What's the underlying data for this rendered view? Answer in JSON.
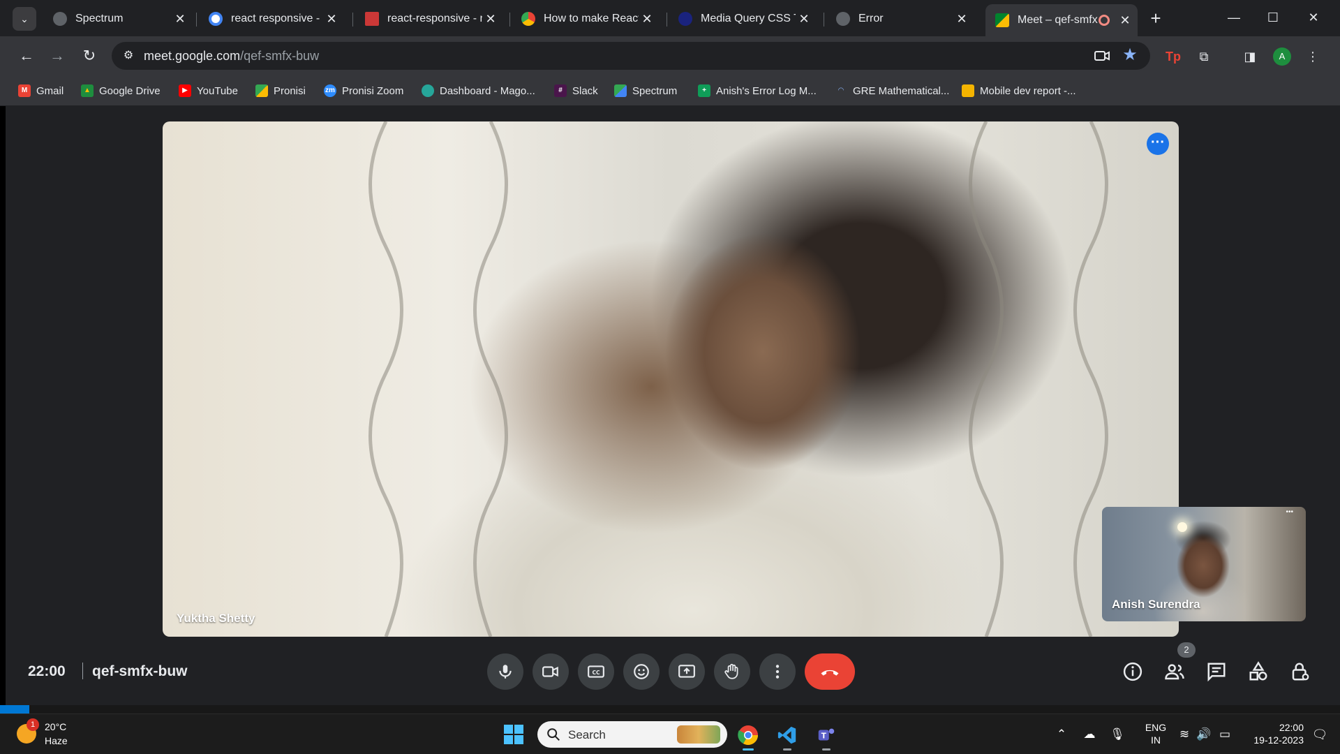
{
  "browser": {
    "tabs": [
      {
        "title": "Spectrum",
        "favicon_color": "#5f6368"
      },
      {
        "title": "react responsive - Go",
        "favicon_color": "#4285f4"
      },
      {
        "title": "react-responsive - np",
        "favicon_color": "#cb3837"
      },
      {
        "title": "How to make React A",
        "favicon_color": "#f4b400"
      },
      {
        "title": "Media Query CSS Tu",
        "favicon_color": "#1a237e"
      },
      {
        "title": "Error",
        "favicon_color": "#5f6368"
      },
      {
        "title": "Meet – qef-smfx",
        "favicon_color": "#00897b",
        "active": true
      }
    ],
    "new_tab": "+",
    "url_host": "meet.google.com",
    "url_path": "/qef-smfx-buw",
    "profile_initial": "A",
    "bookmarks": [
      {
        "label": "Gmail",
        "icon_color": "#ea4335",
        "glyph": "M"
      },
      {
        "label": "Google Drive",
        "icon_color": "#fbbc04",
        "glyph": "▲"
      },
      {
        "label": "YouTube",
        "icon_color": "#ff0000",
        "glyph": "▶"
      },
      {
        "label": "Pronisi",
        "icon_color": "#34a853",
        "glyph": ""
      },
      {
        "label": "Pronisi Zoom",
        "icon_color": "#2d8cff",
        "glyph": "zm"
      },
      {
        "label": "Dashboard - Mago...",
        "icon_color": "#26a69a",
        "glyph": ""
      },
      {
        "label": "Slack",
        "icon_color": "#e01e5a",
        "glyph": "#"
      },
      {
        "label": "Spectrum",
        "icon_color": "#34a853",
        "glyph": ""
      },
      {
        "label": "Anish's Error Log M...",
        "icon_color": "#0f9d58",
        "glyph": "+"
      },
      {
        "label": "GRE Mathematical...",
        "icon_color": "#1a73e8",
        "glyph": "◠"
      },
      {
        "label": "Mobile dev report -...",
        "icon_color": "#f4b400",
        "glyph": ""
      }
    ]
  },
  "meet": {
    "main_participant": "Yuktha Shetty",
    "self_participant": "Anish Surendra",
    "time": "22:00",
    "meeting_code": "qef-smfx-buw",
    "people_count": "2",
    "controls": [
      "microphone",
      "camera",
      "captions",
      "reactions",
      "present",
      "raise-hand",
      "more-options",
      "leave-call"
    ]
  },
  "taskbar": {
    "weather_temp": "20°C",
    "weather_desc": "Haze",
    "weather_badge": "1",
    "search_label": "Search",
    "lang_line1": "ENG",
    "lang_line2": "IN",
    "time": "22:00",
    "date": "19-12-2023"
  }
}
